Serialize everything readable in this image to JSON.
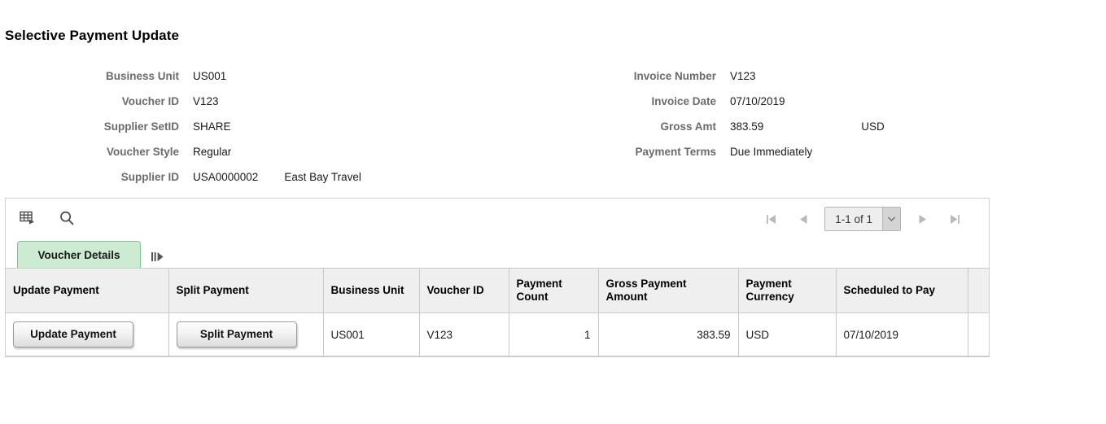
{
  "page": {
    "title": "Selective Payment Update"
  },
  "header_fields": {
    "left": [
      {
        "label": "Business Unit",
        "value": "US001"
      },
      {
        "label": "Voucher ID",
        "value": "V123"
      },
      {
        "label": "Supplier SetID",
        "value": "SHARE"
      },
      {
        "label": "Voucher Style",
        "value": "Regular"
      },
      {
        "label": "Supplier ID",
        "value": "USA0000002",
        "value2": "East Bay Travel"
      }
    ],
    "right": [
      {
        "label": "Invoice Number",
        "value": "V123"
      },
      {
        "label": "Invoice Date",
        "value": "07/10/2019"
      },
      {
        "label": "Gross Amt",
        "value": "383.59",
        "value2": "USD"
      },
      {
        "label": "Payment Terms",
        "value": "Due Immediately"
      }
    ]
  },
  "grid": {
    "toolbar": {
      "personalize_icon": "grid-personalize-icon",
      "find_icon": "search-icon"
    },
    "pager": {
      "first_icon": "first-page-icon",
      "prev_icon": "previous-page-icon",
      "range": "1-1 of 1",
      "dropdown_icon": "chevron-down-icon",
      "next_icon": "next-page-icon",
      "last_icon": "last-page-icon"
    },
    "tabs": [
      {
        "label": "Voucher Details",
        "active": true
      }
    ],
    "show_next_tab_icon": "show-next-columns-icon",
    "columns": [
      "Update Payment",
      "Split Payment",
      "Business Unit",
      "Voucher ID",
      "Payment Count",
      "Gross Payment Amount",
      "Payment Currency",
      "Scheduled to Pay",
      ""
    ],
    "rows": [
      {
        "update_payment_label": "Update Payment",
        "split_payment_label": "Split Payment",
        "business_unit": "US001",
        "voucher_id": "V123",
        "payment_count": "1",
        "gross_payment_amount": "383.59",
        "payment_currency": "USD",
        "scheduled_to_pay": "07/10/2019",
        "spacer": ""
      }
    ]
  },
  "colors": {
    "tab_active_bg": "#cdebd2",
    "tab_active_border": "#7cc48c",
    "header_bg": "#efefef",
    "label_text": "#6b6b6b",
    "border": "#c9c9c9"
  }
}
